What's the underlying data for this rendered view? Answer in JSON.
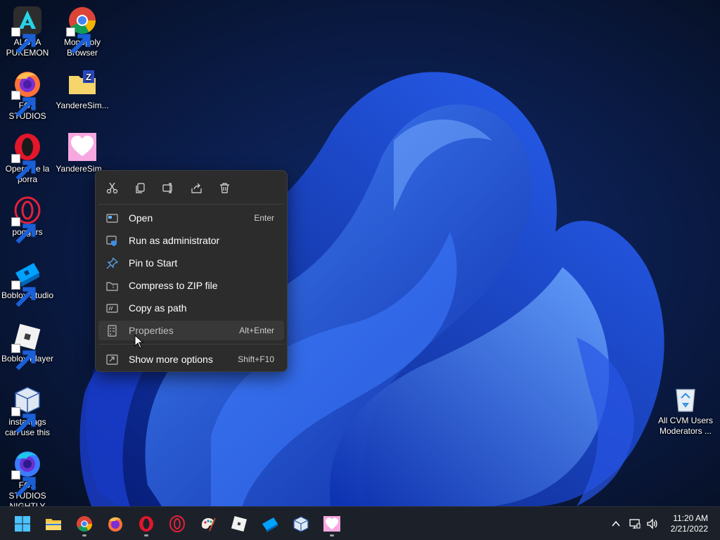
{
  "desktop": {
    "icons": [
      {
        "label": "ALOLA\nPUKEMON",
        "icon": "alola-app-icon",
        "shortcut": true
      },
      {
        "label": "Monopoly\nBrowser",
        "icon": "chrome-icon",
        "shortcut": true
      },
      {
        "label": "FOX STUDIOS",
        "icon": "firefox-icon",
        "shortcut": true
      },
      {
        "label": "YandereSim...",
        "icon": "zip-folder-icon",
        "shortcut": false
      },
      {
        "label": "Opera de la\nporra",
        "icon": "opera-icon",
        "shortcut": true
      },
      {
        "label": "YandereSim...",
        "icon": "heart-app-icon",
        "shortcut": false
      },
      {
        "label": "poggers",
        "icon": "opera-gx-icon",
        "shortcut": true
      },
      {
        "label": "Boblox Studio",
        "icon": "roblox-studio-icon",
        "shortcut": true
      },
      {
        "label": "Boblox Player",
        "icon": "roblox-player-icon",
        "shortcut": true
      },
      {
        "label": "installfags\ncan use this",
        "icon": "virtualbox-icon",
        "shortcut": true
      },
      {
        "label": "FOX STUDIOS\nNIGHTLY",
        "icon": "firefox-nightly-icon",
        "shortcut": true
      },
      {
        "label": "All CVM Users\nModerators ...",
        "icon": "recycle-bin-icon",
        "shortcut": false
      }
    ]
  },
  "context_menu": {
    "toolbar": [
      "cut-icon",
      "copy-icon",
      "rename-icon",
      "share-icon",
      "delete-icon"
    ],
    "items": [
      {
        "label": "Open",
        "shortcut": "Enter",
        "icon": "open-icon"
      },
      {
        "label": "Run as administrator",
        "shortcut": "",
        "icon": "admin-shield-icon"
      },
      {
        "label": "Pin to Start",
        "shortcut": "",
        "icon": "pin-icon"
      },
      {
        "label": "Compress to ZIP file",
        "shortcut": "",
        "icon": "zip-icon"
      },
      {
        "label": "Copy as path",
        "shortcut": "",
        "icon": "copy-path-icon"
      },
      {
        "label": "Properties",
        "shortcut": "Alt+Enter",
        "icon": "properties-icon"
      },
      {
        "label": "Show more options",
        "shortcut": "Shift+F10",
        "icon": "more-options-icon"
      }
    ],
    "hovered_item": "Properties"
  },
  "taskbar": {
    "apps": [
      "start-icon",
      "file-explorer-icon",
      "chrome-icon",
      "firefox-icon",
      "opera-icon",
      "opera-gx-icon",
      "paint-icon",
      "roblox-player-icon",
      "roblox-studio-icon",
      "virtualbox-icon",
      "heart-app-icon"
    ],
    "tray": [
      "chevron-up-icon",
      "network-icon",
      "volume-icon"
    ],
    "time": "11:20 AM",
    "date": "2/21/2022"
  },
  "colors": {
    "wallpaper_bg": "#071127",
    "bloom_blue": "#1f4ff0",
    "menu_bg": "#2c2c2c",
    "taskbar_bg": "#1c2129",
    "accent": "#0078d4"
  }
}
